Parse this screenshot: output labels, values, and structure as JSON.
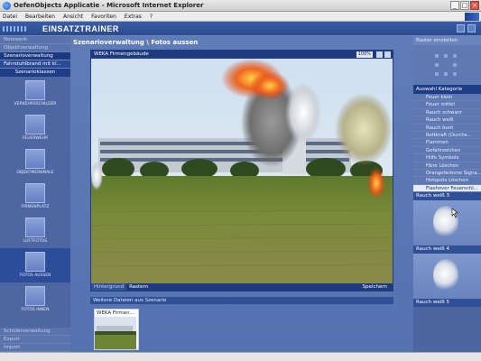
{
  "window": {
    "title": "OefenObjects Applicatie - Microsoft Internet Explorer"
  },
  "menubar": [
    "Datei",
    "Bearbeiten",
    "Ansicht",
    "Favoriten",
    "Extras",
    "?"
  ],
  "app": {
    "title": "EINSATZTRAINER"
  },
  "sidebar": {
    "top_items": [
      "Netzwerk",
      "Objektverwaltung",
      "Szenarioverwaltung",
      "Fahrstuhlbrand mit kl...",
      "Szenarioklassen"
    ],
    "tiles": [
      "VERKEHRSSCHILDER",
      "FEUERWEHR",
      "OBJEKTMERKMALE",
      "FIRMENPLATZ",
      "LUFTFOTOS",
      "FOTOS AUSSEN",
      "FOTOS INNEN"
    ],
    "bottom_items": [
      "Schülerverwaltung",
      "Export",
      "Import"
    ]
  },
  "main": {
    "breadcrumb": "Szenarioverwaltung \\ Fotos aussen",
    "viewer": {
      "title": "WEKA Firmengebäude",
      "zoom": "100%",
      "footer": {
        "hintergrund": "Hintergrund",
        "raster": "Rastern",
        "save": "Speichern"
      }
    },
    "strip_title": "Weitere Dateien aus Szenario",
    "thumbnail_label": "WEKA Firmen..."
  },
  "right": {
    "raster_title": "Raster einstellen",
    "category_title": "Auswahl Kategorie",
    "categories": [
      "Feuer klein",
      "Feuer mittel",
      "Rauch schwarz",
      "Rauch weiß",
      "Rauch bunt",
      "Rettkraft (Durchs...",
      "Flammen",
      "Gefahrzeichen",
      "Hilfe Symbole",
      "Fibre Löschen",
      "Orangefarbene Signa...",
      "Hotspots Löschen",
      "Flashover Feuerschl..."
    ],
    "selected_category_index": 12,
    "rauch": [
      "Rauch weiß 3",
      "Rauch weiß 4",
      "Rauch weiß 5"
    ]
  }
}
